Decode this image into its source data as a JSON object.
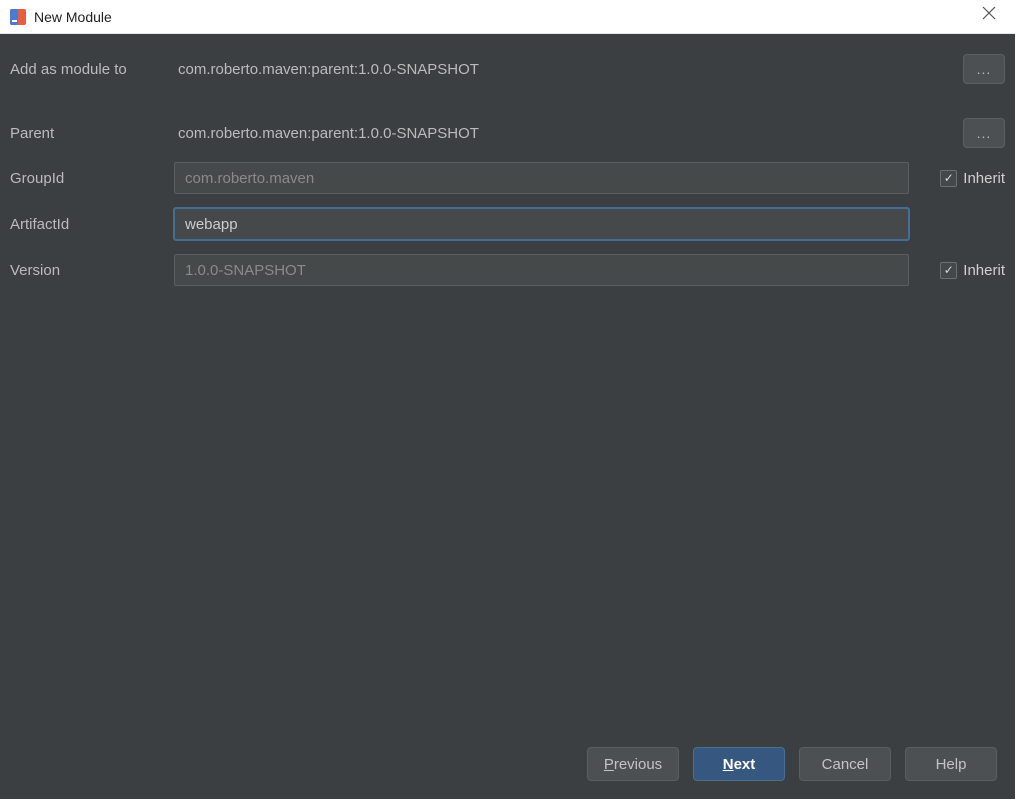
{
  "window": {
    "title": "New Module"
  },
  "form": {
    "add_as_module_label": "Add as module to",
    "add_as_module_value": "com.roberto.maven:parent:1.0.0-SNAPSHOT",
    "parent_label": "Parent",
    "parent_value": "com.roberto.maven:parent:1.0.0-SNAPSHOT",
    "groupid_label": "GroupId",
    "groupid_value": "com.roberto.maven",
    "artifactid_label": "ArtifactId",
    "artifactid_value": "webapp",
    "version_label": "Version",
    "version_value": "1.0.0-SNAPSHOT",
    "inherit_label": "Inherit",
    "ellipsis": "..."
  },
  "footer": {
    "previous": "Previous",
    "next": "Next",
    "cancel": "Cancel",
    "help": "Help"
  }
}
